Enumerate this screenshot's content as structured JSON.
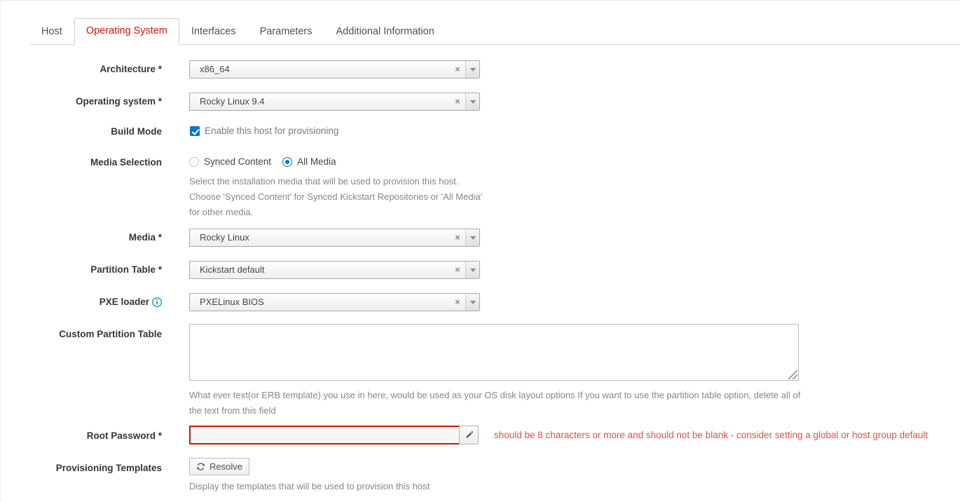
{
  "tabs": [
    {
      "label": "Host",
      "active": false
    },
    {
      "label": "Operating System",
      "active": true
    },
    {
      "label": "Interfaces",
      "active": false
    },
    {
      "label": "Parameters",
      "active": false
    },
    {
      "label": "Additional Information",
      "active": false
    }
  ],
  "fields": {
    "architecture": {
      "label": "Architecture *",
      "value": "x86_64"
    },
    "operating_system": {
      "label": "Operating system *",
      "value": "Rocky Linux 9.4"
    },
    "build_mode": {
      "label": "Build Mode",
      "checkbox_label": "Enable this host for provisioning",
      "checked": true
    },
    "media_selection": {
      "label": "Media Selection",
      "options": [
        {
          "label": "Synced Content",
          "selected": false
        },
        {
          "label": "All Media",
          "selected": true
        }
      ],
      "help": "Select the installation media that will be used to provision this host. Choose 'Synced Content' for Synced Kickstart Repositories or 'All Media' for other media."
    },
    "media": {
      "label": "Media *",
      "value": "Rocky Linux"
    },
    "partition_table": {
      "label": "Partition Table *",
      "value": "Kickstart default"
    },
    "pxe_loader": {
      "label": "PXE loader",
      "value": "PXELinux BIOS",
      "has_info_icon": true
    },
    "custom_partition_table": {
      "label": "Custom Partition Table",
      "value": "",
      "help": "What ever text(or ERB template) you use in here, would be used as your OS disk layout options If you want to use the partition table option, delete all of the text from this field"
    },
    "root_password": {
      "label": "Root Password *",
      "value": "",
      "error": "should be 8 characters or more and should not be blank - consider setting a global or host group default"
    },
    "provisioning_templates": {
      "label": "Provisioning Templates",
      "button_label": "Resolve",
      "help": "Display the templates that will be used to provision this host"
    }
  },
  "icons": {
    "clear": "×",
    "info": "i"
  },
  "colors": {
    "active_tab": "#c9190b",
    "error": "#d9534f",
    "accent": "#0074d9"
  }
}
